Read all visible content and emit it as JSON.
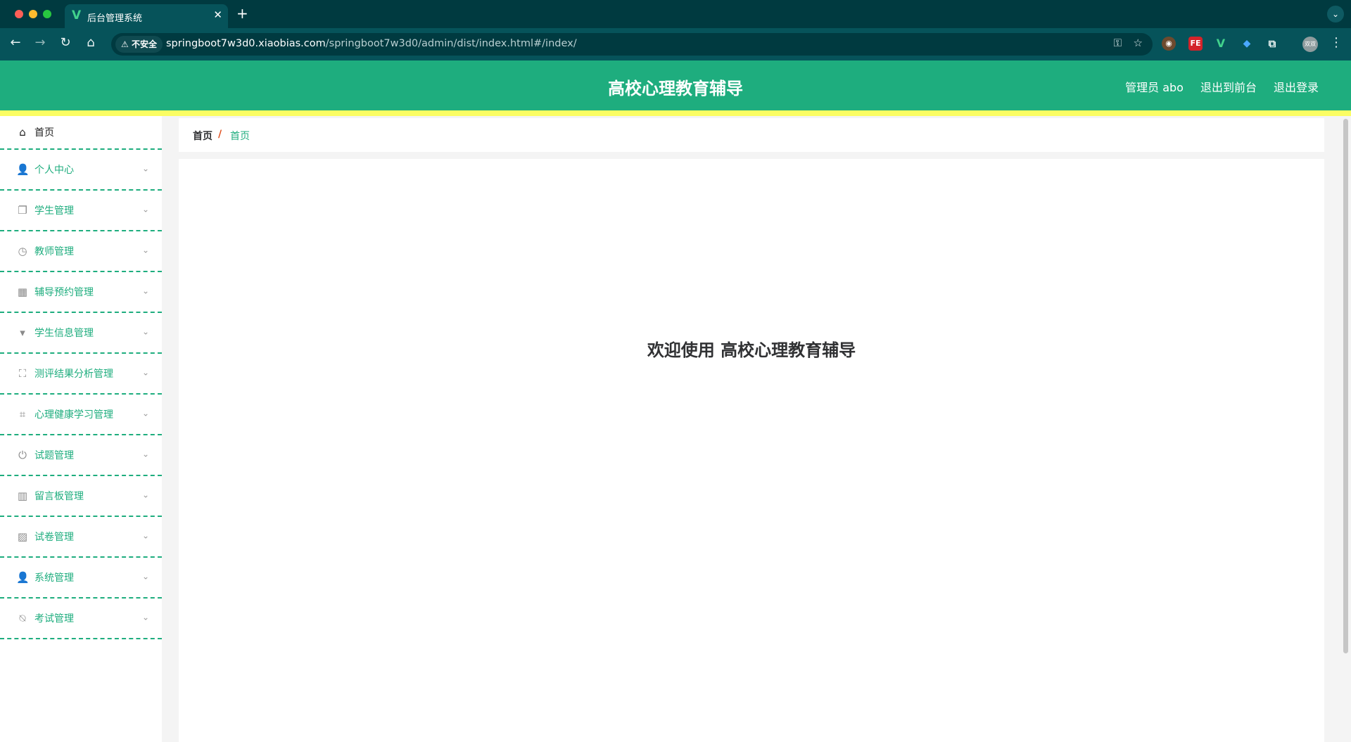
{
  "browser": {
    "tab_title": "后台管理系统",
    "tab_favicon": "V",
    "tab_close": "✕",
    "new_tab": "+",
    "tab_menu": "⌄",
    "insecure_label": "不安全",
    "url_host": "springboot7w3d0.xiaobias.com",
    "url_path": "/springboot7w3d0/admin/dist/index.html#/index/",
    "nav": {
      "back": "←",
      "forward": "→",
      "reload": "↻",
      "home": "⌂"
    },
    "omnibox_icons": {
      "key": "⚿",
      "star": "☆"
    },
    "extensions": [
      {
        "name": "ext-owl",
        "glyph": "◉"
      },
      {
        "name": "ext-fe",
        "glyph": "FE"
      },
      {
        "name": "ext-vue",
        "glyph": "V"
      },
      {
        "name": "ext-pin",
        "glyph": "◆"
      },
      {
        "name": "ext-puzzle",
        "glyph": "⧉"
      }
    ],
    "profile_label": "双双",
    "menu_glyph": "⋮"
  },
  "header": {
    "title": "高校心理教育辅导",
    "links": [
      "管理员 abo",
      "退出到前台",
      "退出登录"
    ]
  },
  "colors": {
    "brand": "#1ead7e",
    "accent_bar": "#fbfd63",
    "breadcrumb_sep": "#e0501f"
  },
  "sidebar": {
    "home": {
      "label": "首页",
      "icon": "home-icon",
      "glyph": "⌂"
    },
    "items": [
      {
        "label": "个人中心",
        "icon": "user-icon",
        "glyph": "👤"
      },
      {
        "label": "学生管理",
        "icon": "copy-icon",
        "glyph": "❐"
      },
      {
        "label": "教师管理",
        "icon": "clock-icon",
        "glyph": "◷"
      },
      {
        "label": "辅导预约管理",
        "icon": "grid-icon",
        "glyph": "▦"
      },
      {
        "label": "学生信息管理",
        "icon": "brush-icon",
        "glyph": "▾"
      },
      {
        "label": "测评结果分析管理",
        "icon": "fullscreen-icon",
        "glyph": "⛶"
      },
      {
        "label": "心理健康学习管理",
        "icon": "crop-icon",
        "glyph": "⌗"
      },
      {
        "label": "试题管理",
        "icon": "power-icon",
        "glyph": "⏻"
      },
      {
        "label": "留言板管理",
        "icon": "library-icon",
        "glyph": "▥"
      },
      {
        "label": "试卷管理",
        "icon": "chart-icon",
        "glyph": "▨"
      },
      {
        "label": "系统管理",
        "icon": "user-icon",
        "glyph": "👤"
      },
      {
        "label": "考试管理",
        "icon": "bell-off-icon",
        "glyph": "⍉"
      }
    ],
    "chevron": "⌄"
  },
  "breadcrumb": {
    "root": "首页",
    "separator": "/",
    "current": "首页"
  },
  "main": {
    "welcome": "欢迎使用 高校心理教育辅导"
  }
}
